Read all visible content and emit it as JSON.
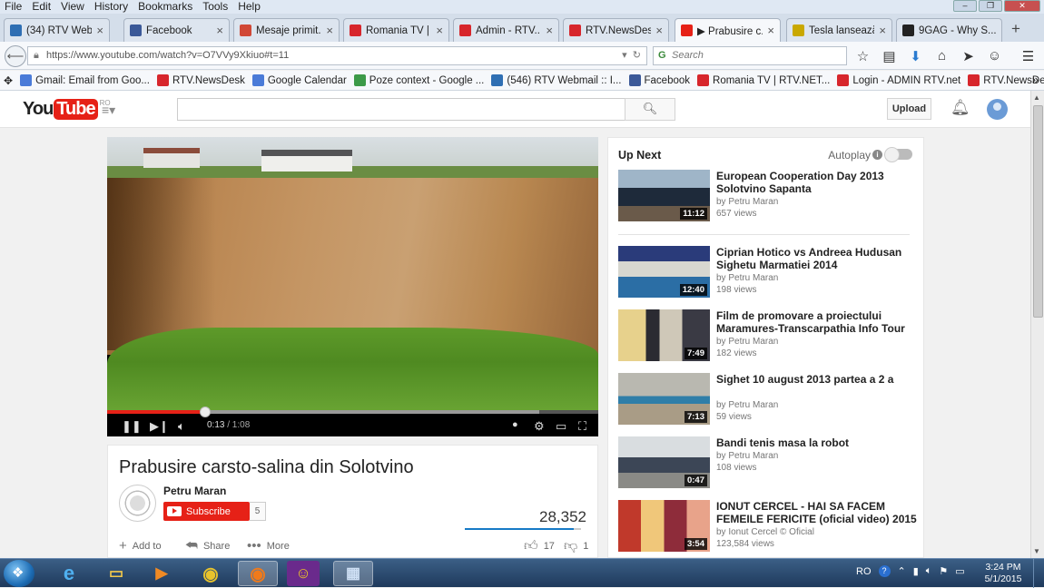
{
  "menubar": [
    "File",
    "Edit",
    "View",
    "History",
    "Bookmarks",
    "Tools",
    "Help"
  ],
  "tabs": [
    {
      "label": "(34) RTV Web...",
      "icon": "globe-icon",
      "color": "#2f6fb3",
      "active": false
    },
    {
      "label": "Facebook",
      "icon": "facebook-icon",
      "color": "#3b5998",
      "active": false
    },
    {
      "label": "Mesaje primit...",
      "icon": "gmail-icon",
      "color": "#d14836",
      "active": false
    },
    {
      "label": "Romania TV | ...",
      "icon": "rtv-icon",
      "color": "#d7262c",
      "active": false
    },
    {
      "label": "Admin - RTV....",
      "icon": "rtv-icon",
      "color": "#d7262c",
      "active": false
    },
    {
      "label": "RTV.NewsDesk",
      "icon": "rtv-icon",
      "color": "#d7262c",
      "active": false
    },
    {
      "label": "▶ Prabusire c...",
      "icon": "youtube-icon",
      "color": "#e62117",
      "active": true
    },
    {
      "label": "Tesla lansează...",
      "icon": "page-icon",
      "color": "#c9a800",
      "active": false
    },
    {
      "label": "9GAG - Why S...",
      "icon": "9gag-icon",
      "color": "#222",
      "active": false
    }
  ],
  "address": {
    "url": "https://www.youtube.com/watch?v=O7VVy9Xkiuo#t=11",
    "search_placeholder": "Search"
  },
  "bookmarks": [
    {
      "label": "Gmail: Email from Goo...",
      "color": "#4a7bd8"
    },
    {
      "label": "RTV.NewsDesk",
      "color": "#d7262c"
    },
    {
      "label": "Google Calendar",
      "color": "#4a7bd8"
    },
    {
      "label": "Poze context - Google ...",
      "color": "#3c9a48"
    },
    {
      "label": "(546) RTV Webmail :: I...",
      "color": "#2f6fb3"
    },
    {
      "label": "Facebook",
      "color": "#3b5998"
    },
    {
      "label": "Romania TV | RTV.NET...",
      "color": "#d7262c"
    },
    {
      "label": "Login - ADMIN RTV.net",
      "color": "#d7262c"
    },
    {
      "label": "RTV.NewsDesk",
      "color": "#d7262c"
    }
  ],
  "masthead": {
    "logo_you": "You",
    "logo_tube": "Tube",
    "logo_region": "RO",
    "upload_label": "Upload"
  },
  "player": {
    "current_time": "0:13",
    "duration": "/ 1:08",
    "played_fraction": 0.2,
    "buffered_fraction": 0.88
  },
  "video": {
    "title": "Prabusire carsto-salina din Solotvino",
    "channel": "Petru Maran",
    "subscribe_label": "Subscribe",
    "subscriber_count": "5",
    "view_count": "28,352",
    "likes": "17",
    "dislikes": "1",
    "like_ratio": 0.94,
    "add_to_label": "Add to",
    "share_label": "Share",
    "more_label": "More"
  },
  "sidebar": {
    "up_next_label": "Up Next",
    "autoplay_label": "Autoplay",
    "items": [
      {
        "title": "European Cooperation Day 2013 Solotvino Sapanta",
        "channel": "by Petru Maran",
        "views": "657 views",
        "duration": "11:12",
        "thumb": "group"
      },
      {
        "title": "Ciprian Hotico vs Andreea Hudusan Sighetu Marmatiei 2014",
        "channel": "by Petru Maran",
        "views": "198 views",
        "duration": "12:40",
        "thumb": "pingpong"
      },
      {
        "title": "Film de promovare a proiectului Maramures-Transcarpathia Info Tour",
        "channel": "by Petru Maran",
        "views": "182 views",
        "duration": "7:49",
        "thumb": "office"
      },
      {
        "title": "Sighet 10 august 2013 partea a 2 a",
        "channel": "by Petru Maran",
        "views": "59 views",
        "duration": "7:13",
        "thumb": "gym"
      },
      {
        "title": "Bandi tenis masa la robot",
        "channel": "by Petru Maran",
        "views": "108 views",
        "duration": "0:47",
        "thumb": "robot"
      },
      {
        "title": "IONUT CERCEL - HAI SA FACEM FEMEILE FERICITE (oficial video) 2015",
        "channel": "by Ionut Cercel © Oficial",
        "views": "123,584 views",
        "duration": "3:54",
        "thumb": "party"
      }
    ]
  },
  "taskbar": {
    "language": "RO",
    "time": "3:24 PM",
    "date": "5/1/2015"
  }
}
